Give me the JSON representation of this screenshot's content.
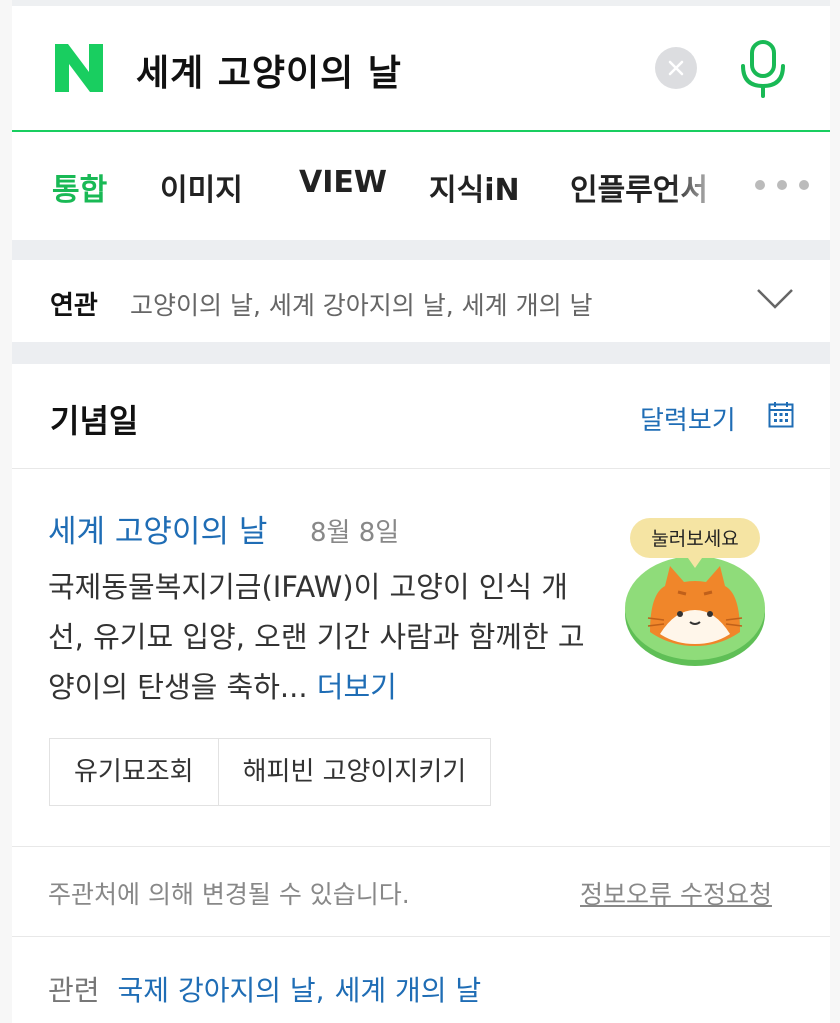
{
  "search": {
    "query": "세계 고양이의 날",
    "clear_icon": "close-icon",
    "mic_icon": "microphone-icon"
  },
  "tabs": [
    {
      "label": "통합",
      "active": true
    },
    {
      "label": "이미지"
    },
    {
      "label": "VIEW"
    },
    {
      "label": "지식iN"
    },
    {
      "label": "인플루언서"
    }
  ],
  "related_searches": {
    "label": "연관",
    "text": "고양이의 날, 세계 강아지의 날, 세계 개의 날"
  },
  "card": {
    "title": "기념일",
    "calendar_link": "달력보기",
    "event_name": "세계 고양이의 날",
    "event_date": "8월 8일",
    "description": "국제동물복지기금(IFAW)이 고양이 인식 개선, 유기묘 입양, 오랜 기간 사람과 함께한 고양이의 탄생을 축하...",
    "more_link": "더보기",
    "badge_text": "눌러보세요",
    "buttons": [
      "유기묘조회",
      "해피빈 고양이지키기"
    ],
    "footer_note": "주관처에 의해 변경될 수 있습니다.",
    "report_link": "정보오류 수정요청",
    "related_label": "관련",
    "related_links": [
      "국제 강아지의 날",
      "세계 개의 날"
    ],
    "related_sep": ","
  },
  "colors": {
    "brand_green": "#19ce60",
    "link_blue": "#1f6db5",
    "badge_green": "#7ed36b",
    "cat_orange": "#f0862a"
  }
}
